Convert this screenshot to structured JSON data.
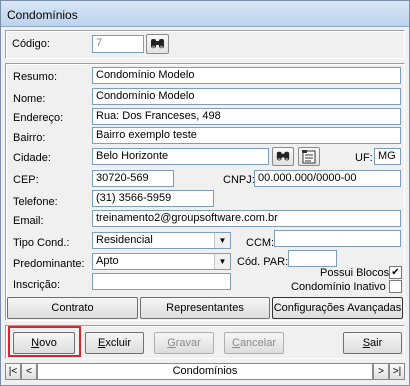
{
  "window": {
    "title": "Condomínios"
  },
  "header": {
    "codigo_label": "Código:",
    "codigo_value": "7"
  },
  "form": {
    "resumo": {
      "label": "Resumo:",
      "value": "Condomínio Modelo"
    },
    "nome": {
      "label": "Nome:",
      "value": "Condomínio Modelo"
    },
    "endereco": {
      "label": "Endereço:",
      "value": "Rua: Dos Franceses, 498"
    },
    "bairro": {
      "label": "Bairro:",
      "value": "Bairro exemplo teste"
    },
    "cidade": {
      "label": "Cidade:",
      "value": "Belo Horizonte"
    },
    "uf": {
      "label": "UF:",
      "value": "MG"
    },
    "cep": {
      "label": "CEP:",
      "value": "30720-569"
    },
    "cnpj": {
      "label": "CNPJ:",
      "value": "00.000.000/0000-00"
    },
    "telefone": {
      "label": "Telefone:",
      "value": "(31) 3566-5959"
    },
    "email": {
      "label": "Email:",
      "value": "treinamento2@groupsoftware.com.br"
    },
    "tipo_cond": {
      "label": "Tipo Cond.:",
      "value": "Residencial"
    },
    "ccm": {
      "label": "CCM:",
      "value": ""
    },
    "predominante": {
      "label": "Predominante:",
      "value": "Apto"
    },
    "cod_par": {
      "label": "Cód. PAR:",
      "value": ""
    },
    "inscricao": {
      "label": "Inscrição:",
      "value": ""
    },
    "possui_blocos": {
      "label": "Possui Blocos",
      "checked": true
    },
    "condominio_inativo": {
      "label": "Condomínio Inativo",
      "checked": false
    }
  },
  "tabs_buttons": {
    "contrato": "Contrato",
    "representantes": "Representantes",
    "configuracoes": "Configurações Avançadas"
  },
  "actions": {
    "novo": {
      "first": "N",
      "rest": "ovo"
    },
    "excluir": {
      "first": "E",
      "rest": "xcluir"
    },
    "gravar": {
      "first": "G",
      "rest": "ravar"
    },
    "cancelar": {
      "first": "C",
      "rest": "ancelar"
    },
    "sair": {
      "first": "S",
      "rest": "air"
    }
  },
  "navigator": {
    "first": "|<",
    "prev": "<",
    "label": "Condomínios",
    "next": ">",
    "last": ">|"
  },
  "colors": {
    "highlight": "#d9262a",
    "title_bar": "#c9dcf2"
  }
}
